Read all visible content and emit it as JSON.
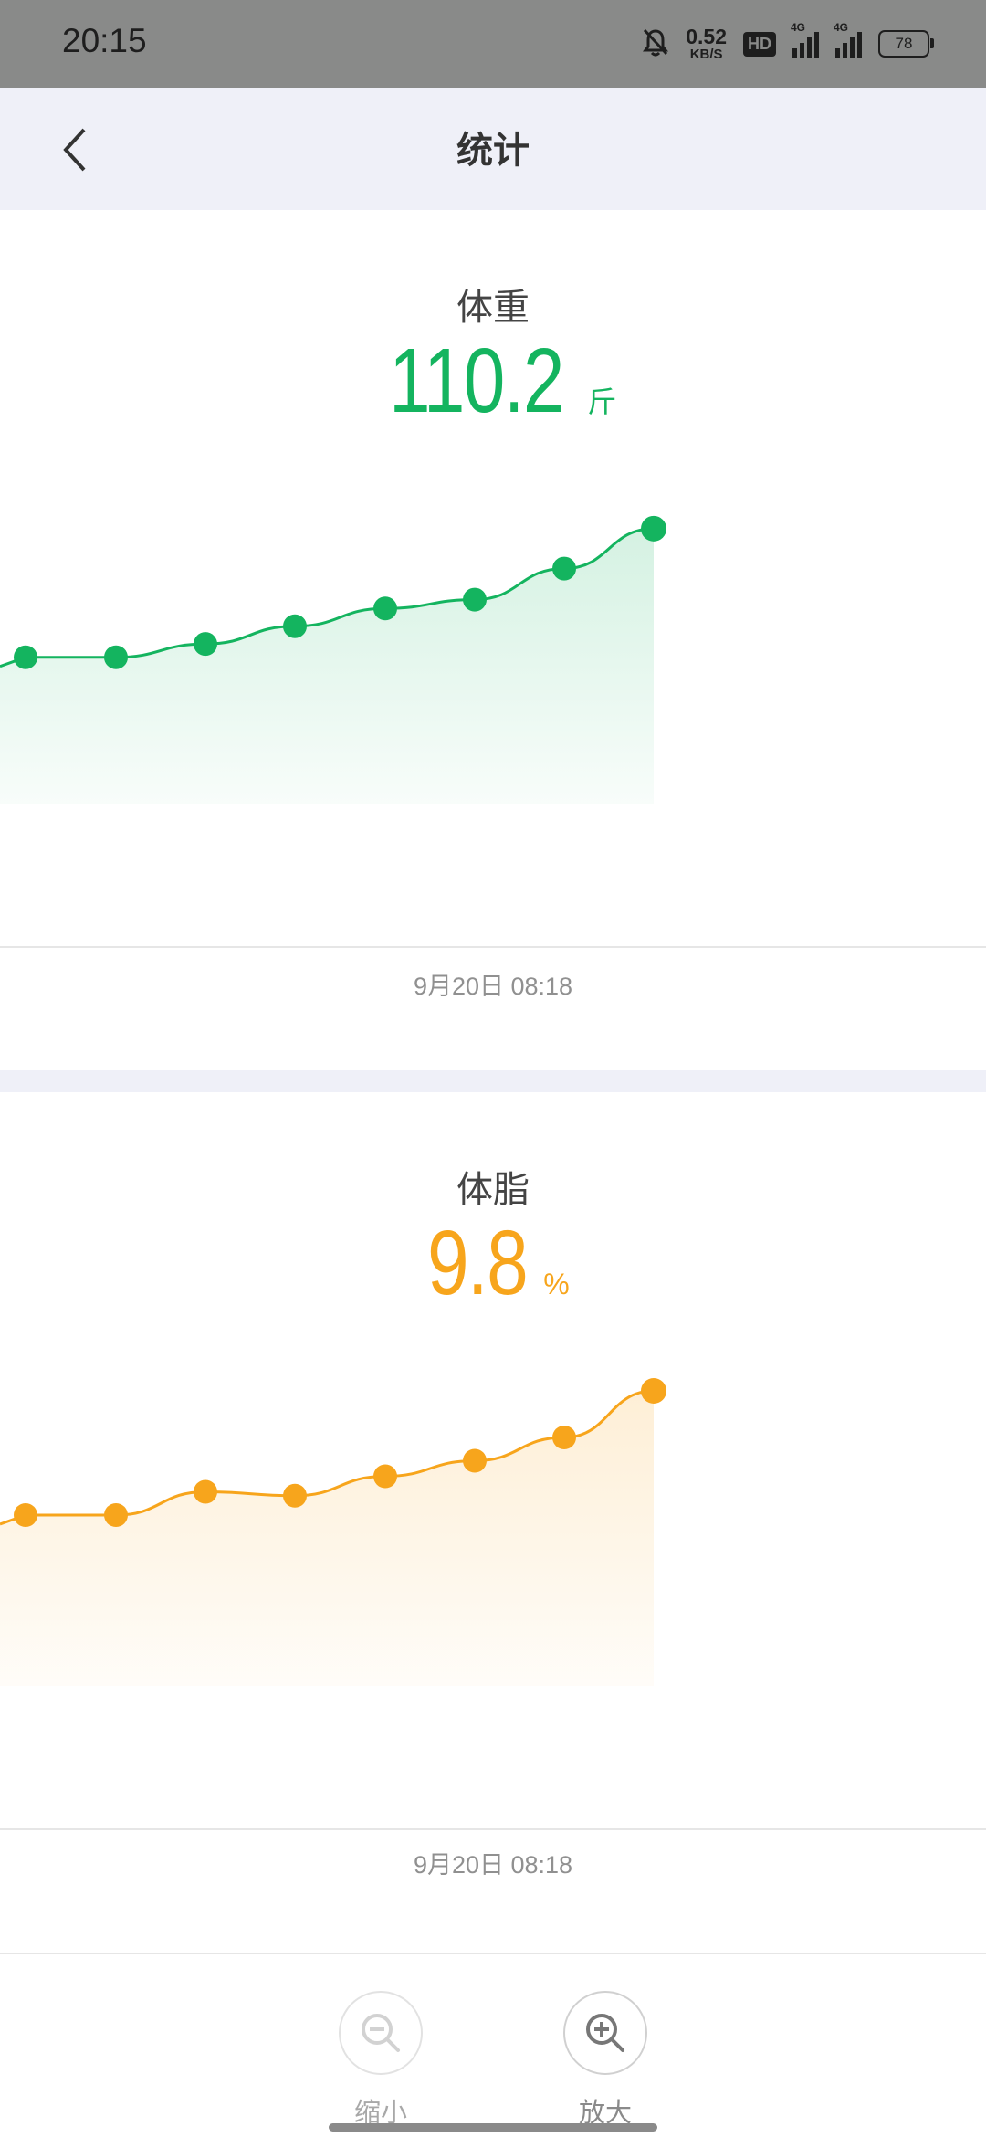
{
  "status_bar": {
    "time": "20:15",
    "net_speed_value": "0.52",
    "net_speed_unit": "KB/S",
    "hd_badge": "HD",
    "signal1_label": "4G",
    "signal2_label": "4G",
    "battery": "78",
    "icons": [
      "bell-muted-icon",
      "hd-icon",
      "signal-icon",
      "signal-icon",
      "battery-icon"
    ]
  },
  "header": {
    "title": "统计",
    "back_icon": "chevron-left-icon"
  },
  "weight": {
    "label": "体重",
    "value": "110.2",
    "unit": "斤",
    "date": "9月20日 08:18",
    "color": "#14b45f"
  },
  "body_fat": {
    "label": "体脂",
    "value": "9.8",
    "unit": "%",
    "date": "9月20日 08:18",
    "color": "#f7a51c"
  },
  "chart_data": [
    {
      "type": "line",
      "title": "体重",
      "xlabel": "",
      "ylabel": "",
      "x": [
        1,
        2,
        3,
        4,
        5,
        6,
        7,
        8
      ],
      "series": [
        {
          "values": [
            107.3,
            107.3,
            107.6,
            108.0,
            108.4,
            108.6,
            109.3,
            110.2
          ]
        }
      ],
      "ylim": [
        104,
        111
      ],
      "area_fill": true,
      "grid": false,
      "color": "#14b45f"
    },
    {
      "type": "line",
      "title": "体脂",
      "xlabel": "",
      "ylabel": "",
      "x": [
        1,
        2,
        3,
        4,
        5,
        6,
        7,
        8
      ],
      "series": [
        {
          "values": [
            8.2,
            8.2,
            8.5,
            8.45,
            8.7,
            8.9,
            9.2,
            9.8
          ]
        }
      ],
      "ylim": [
        6,
        10
      ],
      "area_fill": true,
      "grid": false,
      "color": "#f7a51c"
    }
  ],
  "zoom": {
    "out_label": "缩小",
    "in_label": "放大",
    "out_icon": "zoom-out-icon",
    "in_icon": "zoom-in-icon"
  }
}
